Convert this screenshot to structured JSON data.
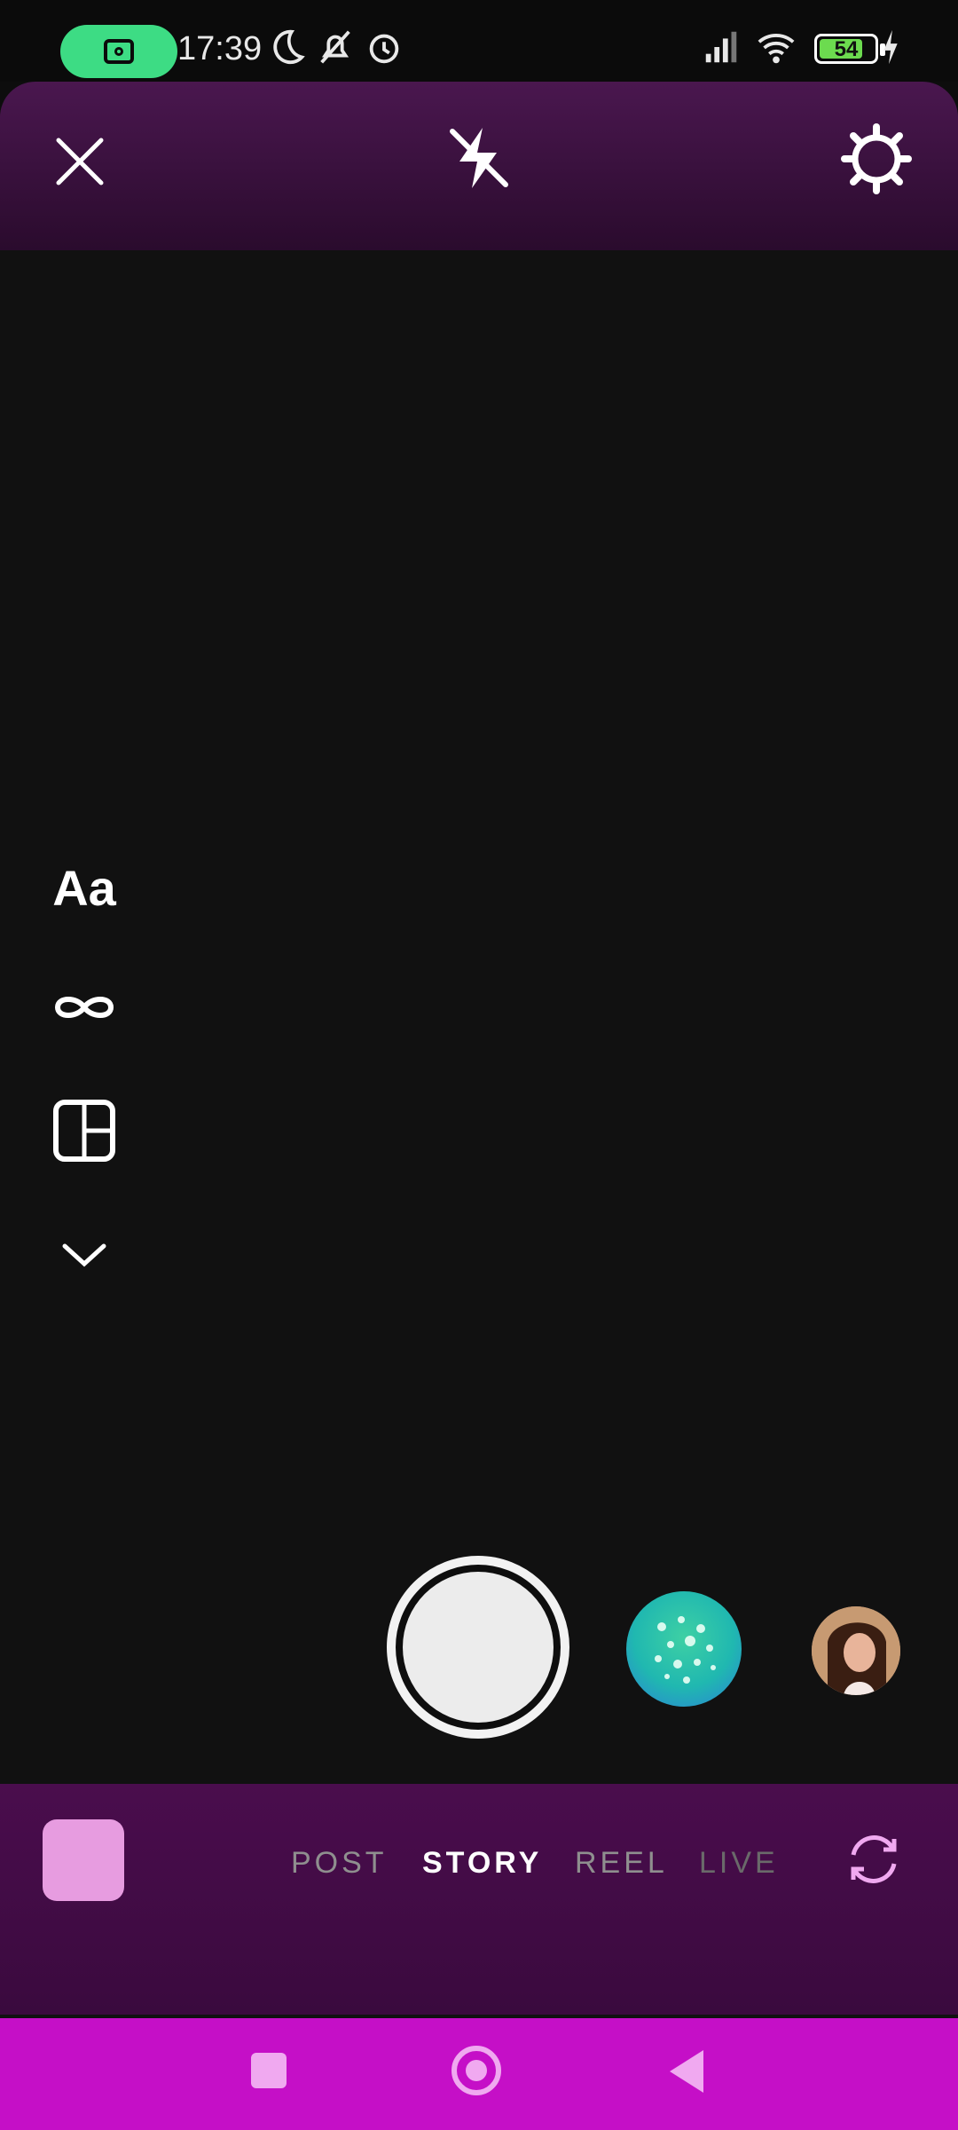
{
  "status_bar": {
    "time": "17:39",
    "battery": "54",
    "icons": [
      "camera-app-icon",
      "moon-icon",
      "bell-off-icon",
      "alarm-icon",
      "signal-icon",
      "wifi-icon",
      "battery-icon",
      "charging-icon"
    ],
    "accent": "#3ddc84"
  },
  "toolbar": {
    "icons": [
      "close-icon",
      "flash-off-icon",
      "settings-icon"
    ]
  },
  "side_tools": {
    "text_tool": "Aa",
    "icons": [
      "infinity-icon",
      "layout-grid-icon",
      "chevron-down-icon"
    ]
  },
  "capture": {
    "icons": [
      "shutter-button",
      "effect-thumbnail",
      "profile-avatar"
    ]
  },
  "modes": {
    "items": [
      "POST",
      "STORY",
      "REEL",
      "LIVE"
    ],
    "active": "STORY",
    "icons": [
      "gallery-thumbnail",
      "flip-camera-icon"
    ]
  },
  "nav": {
    "icons": [
      "recents-icon",
      "home-icon",
      "back-icon"
    ],
    "color": "#c50fc7"
  }
}
